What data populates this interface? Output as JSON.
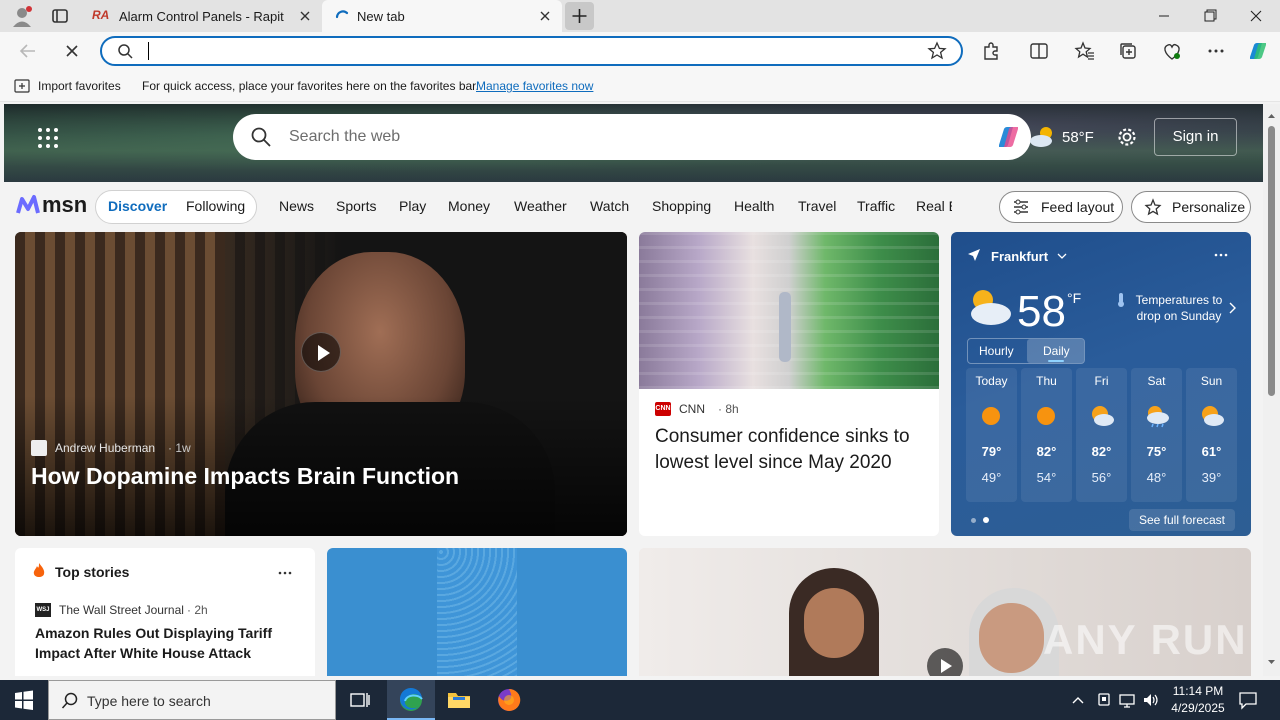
{
  "browser": {
    "tabs": [
      {
        "title": "Alarm Control Panels - Rapitec",
        "favicon_text": "RA"
      },
      {
        "title": "New tab"
      }
    ],
    "address_value": "",
    "favorites_bar": {
      "import_label": "Import favorites",
      "message": "For quick access, place your favorites here on the favorites bar.",
      "link": "Manage favorites now"
    }
  },
  "msn": {
    "search_placeholder": "Search the web",
    "weather_temp": "58°F",
    "sign_in": "Sign in",
    "logo_text": "msn",
    "feed_tabs": [
      "Discover",
      "Following"
    ],
    "nav": [
      "News",
      "Sports",
      "Play",
      "Money",
      "Weather",
      "Watch",
      "Shopping",
      "Health",
      "Travel",
      "Traffic",
      "Real E"
    ],
    "feed_layout": "Feed layout",
    "personalize": "Personalize"
  },
  "hero_card": {
    "source": "Andrew Huberman",
    "age": "1w",
    "title": "How Dopamine Impacts Brain Function"
  },
  "cnn_card": {
    "source": "CNN",
    "age": "8h",
    "title": "Consumer confidence sinks to lowest level since May 2020"
  },
  "weather": {
    "city": "Frankfurt",
    "temp": "58",
    "unit": "°F",
    "alert": "Temperatures to drop on Sunday",
    "tabs": [
      "Hourly",
      "Daily"
    ],
    "days": [
      {
        "day": "Today",
        "high": "79°",
        "low": "49°",
        "icon": "sun"
      },
      {
        "day": "Thu",
        "high": "82°",
        "low": "54°",
        "icon": "sun"
      },
      {
        "day": "Fri",
        "high": "82°",
        "low": "56°",
        "icon": "partly-cloudy"
      },
      {
        "day": "Sat",
        "high": "75°",
        "low": "48°",
        "icon": "rain-cloud"
      },
      {
        "day": "Sun",
        "high": "61°",
        "low": "39°",
        "icon": "partly-cloudy"
      }
    ],
    "see_full": "See full forecast"
  },
  "top_stories": {
    "heading": "Top stories",
    "source": "The Wall Street Journal",
    "source_abbr": "WSJ",
    "age": "2h",
    "title": "Amazon Rules Out Displaying Tariff Impact After White House Attack"
  },
  "taskbar": {
    "search_placeholder": "Type here to search",
    "time": "11:14 PM",
    "date": "4/29/2025"
  },
  "watermark": "ANY RUN"
}
